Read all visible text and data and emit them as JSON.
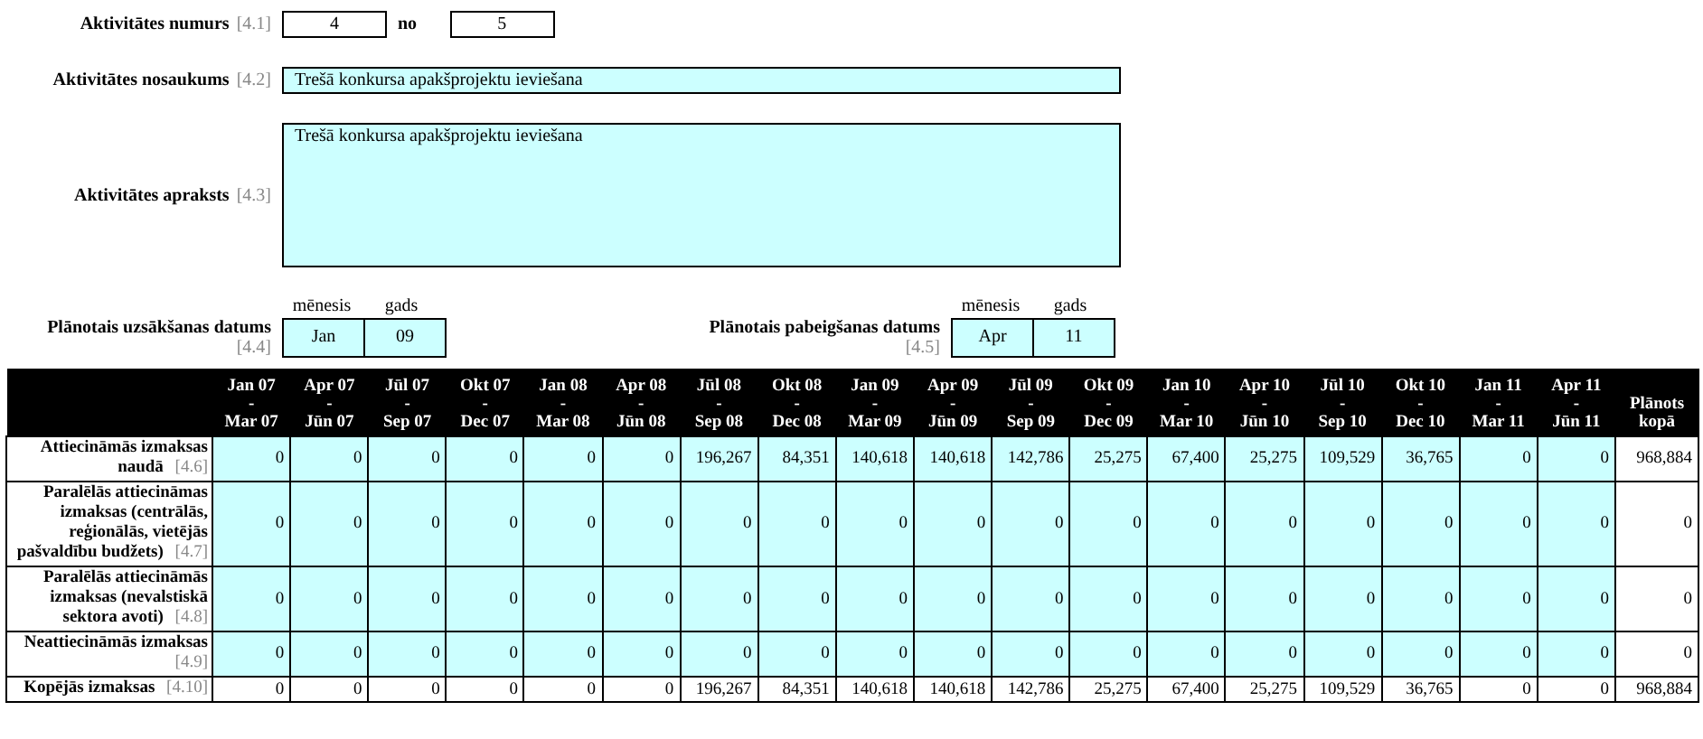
{
  "activity_number": {
    "label": "Aktivitātes numurs",
    "ref": "[4.1]",
    "value": "4",
    "separator": "no",
    "total": "5"
  },
  "activity_name": {
    "label": "Aktivitātes nosaukums",
    "ref": "[4.2]",
    "value": "Trešā konkursa apakšprojektu ieviešana"
  },
  "activity_description": {
    "label": "Aktivitātes apraksts",
    "ref": "[4.3]",
    "value": "Trešā konkursa apakšprojektu ieviešana"
  },
  "start_date": {
    "label": "Plānotais uzsākšanas datums",
    "ref": "[4.4]",
    "month_label": "mēnesis",
    "year_label": "gads",
    "month": "Jan",
    "year": "09"
  },
  "end_date": {
    "label": "Plānotais pabeigšanas datums",
    "ref": "[4.5]",
    "month_label": "mēnesis",
    "year_label": "gads",
    "month": "Apr",
    "year": "11"
  },
  "table": {
    "columns": [
      {
        "from": "Jan 07",
        "dash": "-",
        "to": "Mar 07"
      },
      {
        "from": "Apr 07",
        "dash": "-",
        "to": "Jūn 07"
      },
      {
        "from": "Jūl 07",
        "dash": "-",
        "to": "Sep 07"
      },
      {
        "from": "Okt 07",
        "dash": "-",
        "to": "Dec 07"
      },
      {
        "from": "Jan 08",
        "dash": "-",
        "to": "Mar 08"
      },
      {
        "from": "Apr 08",
        "dash": "-",
        "to": "Jūn 08"
      },
      {
        "from": "Jūl 08",
        "dash": "-",
        "to": "Sep 08"
      },
      {
        "from": "Okt 08",
        "dash": "-",
        "to": "Dec 08"
      },
      {
        "from": "Jan 09",
        "dash": "-",
        "to": "Mar 09"
      },
      {
        "from": "Apr 09",
        "dash": "-",
        "to": "Jūn 09"
      },
      {
        "from": "Jūl 09",
        "dash": "-",
        "to": "Sep 09"
      },
      {
        "from": "Okt 09",
        "dash": "-",
        "to": "Dec 09"
      },
      {
        "from": "Jan 10",
        "dash": "-",
        "to": "Mar 10"
      },
      {
        "from": "Apr 10",
        "dash": "-",
        "to": "Jūn 10"
      },
      {
        "from": "Jūl 10",
        "dash": "-",
        "to": "Sep 10"
      },
      {
        "from": "Okt 10",
        "dash": "-",
        "to": "Dec 10"
      },
      {
        "from": "Jan 11",
        "dash": "-",
        "to": "Mar 11"
      },
      {
        "from": "Apr 11",
        "dash": "-",
        "to": "Jūn 11"
      }
    ],
    "total_header": "Plānots kopā",
    "rows": [
      {
        "label": "Attiecināmās izmaksas naudā",
        "ref": "[4.6]",
        "kind": "input",
        "values": [
          "0",
          "0",
          "0",
          "0",
          "0",
          "0",
          "196,267",
          "84,351",
          "140,618",
          "140,618",
          "142,786",
          "25,275",
          "67,400",
          "25,275",
          "109,529",
          "36,765",
          "0",
          "0"
        ],
        "total": "968,884"
      },
      {
        "label": "Paralēlās attiecināmas izmaksas (centrālās, reģionālās, vietējās pašvaldību budžets)",
        "ref": "[4.7]",
        "kind": "input",
        "values": [
          "0",
          "0",
          "0",
          "0",
          "0",
          "0",
          "0",
          "0",
          "0",
          "0",
          "0",
          "0",
          "0",
          "0",
          "0",
          "0",
          "0",
          "0"
        ],
        "total": "0"
      },
      {
        "label": "Paralēlās attiecināmās izmaksas (nevalstiskā sektora avoti)",
        "ref": "[4.8]",
        "kind": "input",
        "values": [
          "0",
          "0",
          "0",
          "0",
          "0",
          "0",
          "0",
          "0",
          "0",
          "0",
          "0",
          "0",
          "0",
          "0",
          "0",
          "0",
          "0",
          "0"
        ],
        "total": "0"
      },
      {
        "label": "Neattiecināmās izmaksas",
        "ref": "[4.9]",
        "kind": "input",
        "values": [
          "0",
          "0",
          "0",
          "0",
          "0",
          "0",
          "0",
          "0",
          "0",
          "0",
          "0",
          "0",
          "0",
          "0",
          "0",
          "0",
          "0",
          "0"
        ],
        "total": "0"
      },
      {
        "label": "Kopējās izmaksas",
        "ref": "[4.10]",
        "kind": "total",
        "values": [
          "0",
          "0",
          "0",
          "0",
          "0",
          "0",
          "196,267",
          "84,351",
          "140,618",
          "140,618",
          "142,786",
          "25,275",
          "67,400",
          "25,275",
          "109,529",
          "36,765",
          "0",
          "0"
        ],
        "total": "968,884"
      }
    ]
  }
}
